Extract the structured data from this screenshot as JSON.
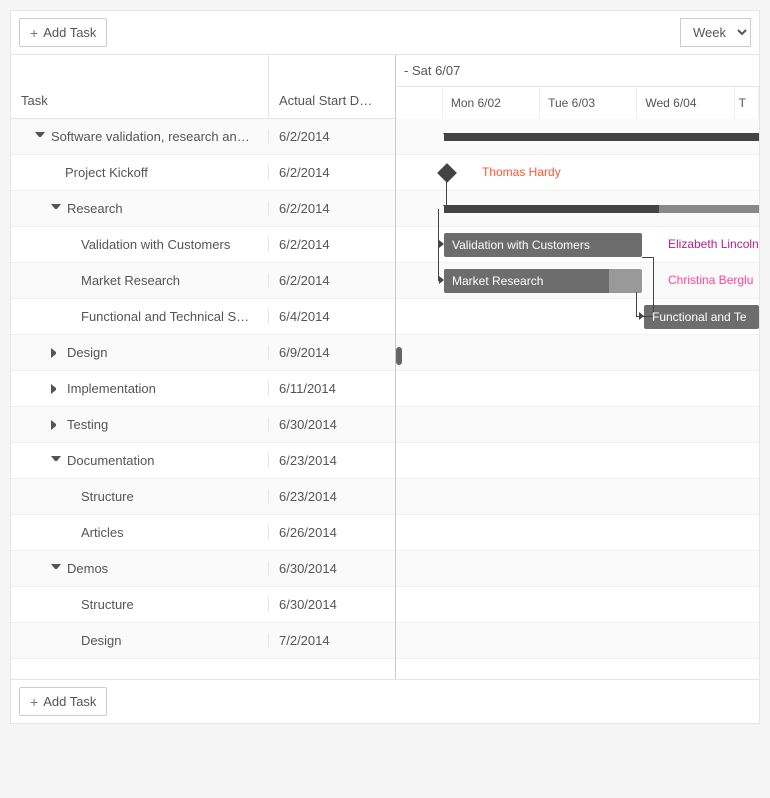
{
  "toolbar": {
    "add_task_label": "Add Task",
    "view_select": "Week"
  },
  "columns": {
    "task": "Task",
    "start_date": "Actual Start D…"
  },
  "timeline": {
    "range_label": "- Sat 6/07",
    "days": [
      "Mon 6/02",
      "Tue 6/03",
      "Wed 6/04",
      "T"
    ]
  },
  "tasks": [
    {
      "title": "Software validation, research an…",
      "date": "6/2/2014",
      "indent": 0,
      "expandable": true,
      "expanded": true
    },
    {
      "title": "Project Kickoff",
      "date": "6/2/2014",
      "indent": 1,
      "expandable": false
    },
    {
      "title": "Research",
      "date": "6/2/2014",
      "indent": 1,
      "expandable": true,
      "expanded": true
    },
    {
      "title": "Validation with Customers",
      "date": "6/2/2014",
      "indent": 2,
      "expandable": false
    },
    {
      "title": "Market Research",
      "date": "6/2/2014",
      "indent": 2,
      "expandable": false
    },
    {
      "title": "Functional and Technical S…",
      "date": "6/4/2014",
      "indent": 2,
      "expandable": false
    },
    {
      "title": "Design",
      "date": "6/9/2014",
      "indent": 1,
      "expandable": true,
      "expanded": false
    },
    {
      "title": "Implementation",
      "date": "6/11/2014",
      "indent": 1,
      "expandable": true,
      "expanded": false
    },
    {
      "title": "Testing",
      "date": "6/30/2014",
      "indent": 1,
      "expandable": true,
      "expanded": false
    },
    {
      "title": "Documentation",
      "date": "6/23/2014",
      "indent": 1,
      "expandable": true,
      "expanded": true
    },
    {
      "title": "Structure",
      "date": "6/23/2014",
      "indent": 2,
      "expandable": false
    },
    {
      "title": "Articles",
      "date": "6/26/2014",
      "indent": 2,
      "expandable": false
    },
    {
      "title": "Demos",
      "date": "6/30/2014",
      "indent": 1,
      "expandable": true,
      "expanded": true
    },
    {
      "title": "Structure",
      "date": "6/30/2014",
      "indent": 2,
      "expandable": false
    },
    {
      "title": "Design",
      "date": "7/2/2014",
      "indent": 2,
      "expandable": false
    }
  ],
  "bars": {
    "validation_label": "Validation with Customers",
    "market_label": "Market Research",
    "functional_label": "Functional and Te"
  },
  "resources": {
    "kickoff": "Thomas Hardy",
    "validation": "Elizabeth Lincoln",
    "market": "Christina Berglu"
  }
}
